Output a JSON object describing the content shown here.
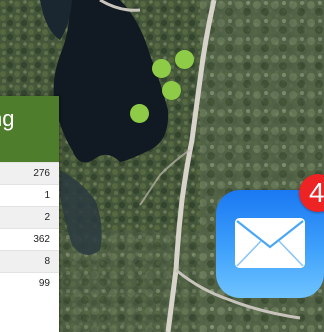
{
  "map": {
    "colors": {
      "forest": "#3f5236",
      "lake": "#111a22",
      "road": "#d4d0c6",
      "marker": "#8ecb46"
    },
    "markers": [
      {
        "label": "marker-1"
      },
      {
        "label": "marker-2"
      },
      {
        "label": "marker-3"
      },
      {
        "label": "marker-4"
      }
    ]
  },
  "panel": {
    "title": "ng",
    "header_color": "#4e7d2c",
    "rows": [
      "276",
      "1",
      "2",
      "362",
      "8",
      "99"
    ]
  },
  "mail_app": {
    "icon": "envelope-icon",
    "badge_count": "4",
    "badge_color": "#ee2323"
  }
}
